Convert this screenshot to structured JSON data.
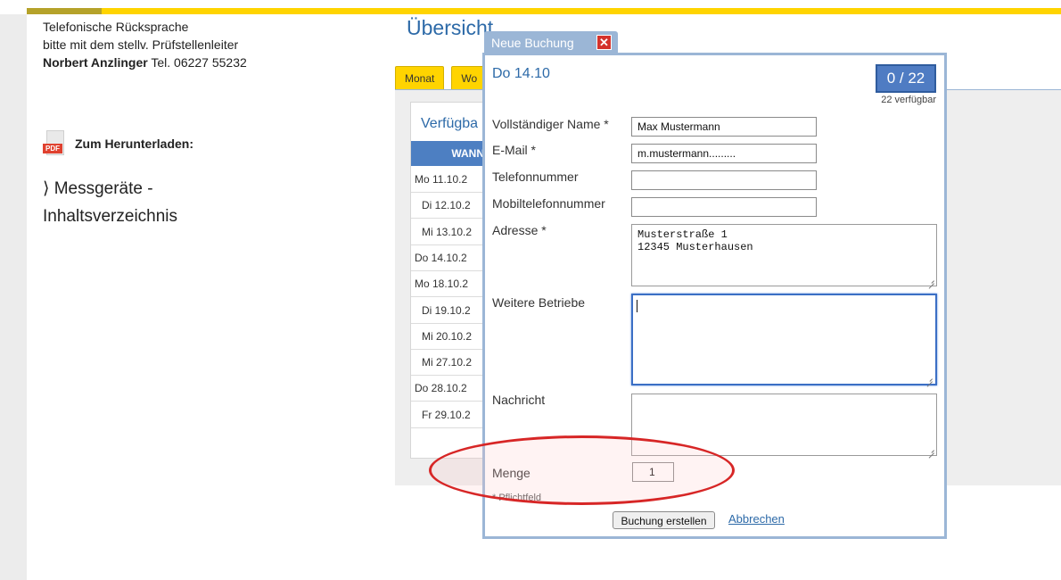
{
  "sidebar": {
    "contact_line1": "Telefonische Rücksprache",
    "contact_line2": "bitte mit dem stellv. Prüfstellenleiter",
    "contact_name": "Norbert Anzlinger",
    "contact_phone": "Tel. 06227 55232",
    "download_label": "Zum Herunterladen:",
    "pdf_tag": "PDF",
    "link_line1": "⟩ Messgeräte -",
    "link_line2": "Inhaltsverzeichnis"
  },
  "main": {
    "title": "Übersicht",
    "tabs": [
      {
        "label": "Monat"
      },
      {
        "label": "Wo"
      }
    ],
    "availability_title": "Verfügba",
    "table_header": "WANN",
    "dates": [
      "Mo 11.10.2",
      "Di 12.10.2",
      "Mi 13.10.2",
      "Do 14.10.2",
      "Mo 18.10.2",
      "Di 19.10.2",
      "Mi 20.10.2",
      "Mi 27.10.2",
      "Do 28.10.2",
      "Fr 29.10.2"
    ]
  },
  "dialog": {
    "title": "Neue Buchung",
    "close_glyph": "✕",
    "date": "Do 14.10",
    "counter": "0 / 22",
    "counter_sub": "22 verfügbar",
    "fields": {
      "name_label": "Vollständiger Name *",
      "name_value": "Max Mustermann",
      "email_label": "E-Mail *",
      "email_value": "m.mustermann.........",
      "phone_label": "Telefonnummer",
      "phone_value": "",
      "mobile_label": "Mobiltelefonnummer",
      "mobile_value": "",
      "address_label": "Adresse *",
      "address_value": "Musterstraße 1\n12345 Musterhausen",
      "other_label": "Weitere Betriebe",
      "other_value": "",
      "message_label": "Nachricht",
      "message_value": "",
      "quantity_label": "Menge",
      "quantity_value": "1"
    },
    "required_hint": "* Pflichtfeld",
    "submit_label": "Buchung erstellen",
    "cancel_label": "Abbrechen"
  },
  "colors": {
    "accent_yellow": "#ffd400",
    "title_blue": "#2d6aa8",
    "header_blue": "#4d7fc2",
    "dialog_border": "#9bb6d6",
    "highlight_red": "#d72626"
  }
}
